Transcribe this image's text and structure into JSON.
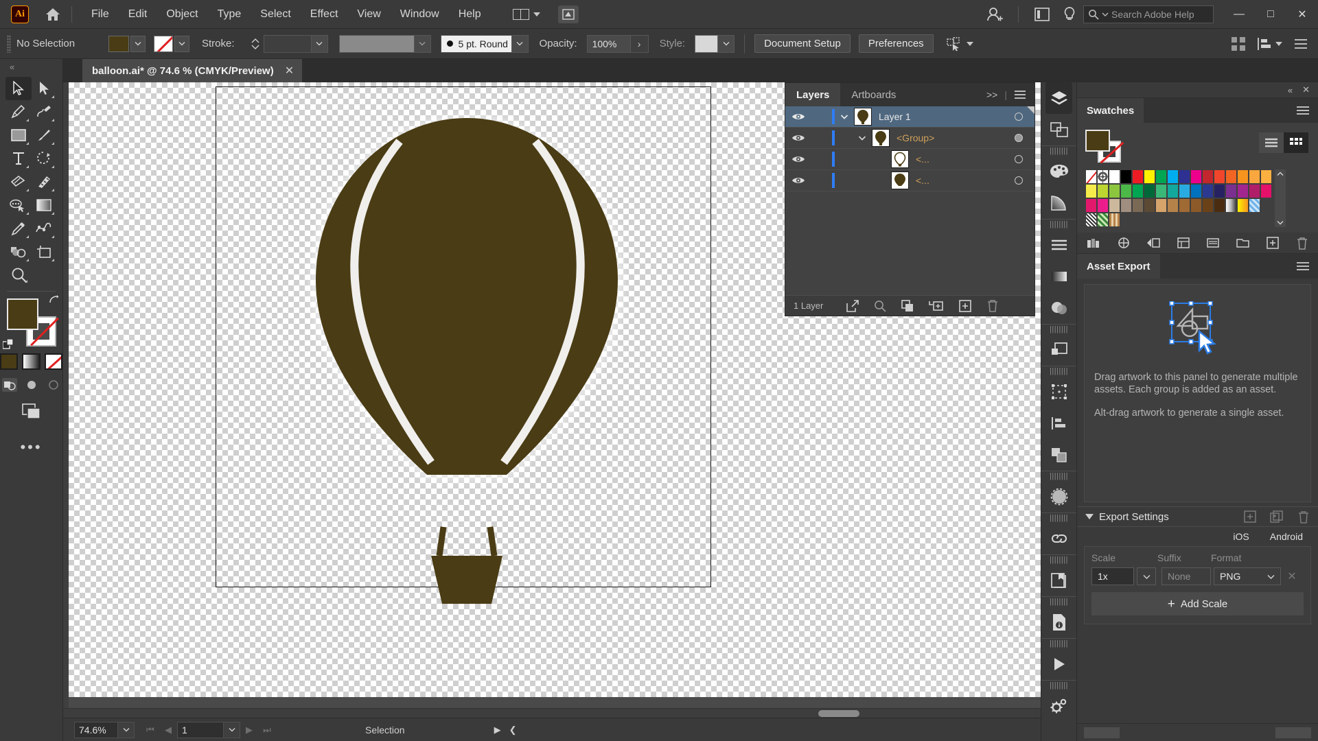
{
  "app": {
    "logo": "Ai",
    "name": "Adobe Illustrator"
  },
  "menubar": {
    "items": [
      "File",
      "Edit",
      "Object",
      "Type",
      "Select",
      "Effect",
      "View",
      "Window",
      "Help"
    ],
    "search_placeholder": "Search Adobe Help",
    "window_controls": {
      "minimize": "—",
      "maximize": "□",
      "close": "✕"
    }
  },
  "controlbar": {
    "selection_status": "No Selection",
    "fill_color": "#4a3c14",
    "stroke_color": "None",
    "stroke_label": "Stroke:",
    "stroke_weight": "",
    "variable_width_profile": "",
    "brush_definition": "5 pt. Round",
    "opacity_label": "Opacity:",
    "opacity_value": "100%",
    "style_label": "Style:",
    "document_setup_label": "Document Setup",
    "preferences_label": "Preferences"
  },
  "toolbar": {
    "tools": [
      {
        "name": "selection-tool",
        "active": true
      },
      {
        "name": "direct-selection-tool",
        "active": false
      },
      {
        "name": "pen-tool",
        "active": false
      },
      {
        "name": "curvature-tool",
        "active": false
      },
      {
        "name": "rectangle-tool",
        "active": false
      },
      {
        "name": "paintbrush-tool",
        "active": false
      },
      {
        "name": "type-tool",
        "active": false
      },
      {
        "name": "rotate-tool",
        "active": false
      },
      {
        "name": "eraser-tool",
        "active": false
      },
      {
        "name": "scale-tool",
        "active": false
      },
      {
        "name": "width-tool",
        "active": false
      },
      {
        "name": "gradient-tool",
        "active": false
      },
      {
        "name": "eyedropper-tool",
        "active": false
      },
      {
        "name": "blend-tool",
        "active": false
      },
      {
        "name": "shape-builder-tool",
        "active": false
      },
      {
        "name": "artboard-tool",
        "active": false
      },
      {
        "name": "zoom-tool",
        "active": false
      }
    ],
    "fill_color": "#4a3c14",
    "stroke_color": "None",
    "more_tools": "•••"
  },
  "document": {
    "tab_title": "balloon.ai* @ 74.6 % (CMYK/Preview)",
    "close_label": "✕",
    "artwork": {
      "name": "hot-air-balloon",
      "fill": "#4a3c14"
    }
  },
  "statusbar": {
    "zoom_level": "74.6%",
    "page_number": "1",
    "status_text": "Selection"
  },
  "layers_panel": {
    "tabs": [
      {
        "label": "Layers",
        "active": true
      },
      {
        "label": "Artboards",
        "active": false
      }
    ],
    "expand_label": ">>",
    "rows": [
      {
        "name": "Layer 1",
        "selected": true,
        "expanded": true,
        "indent": 0,
        "thumb": "balloon-dark",
        "target_filled": false,
        "has_corner": true
      },
      {
        "name": "<Group>",
        "selected": false,
        "expanded": true,
        "indent": 1,
        "thumb": "balloon-dark",
        "target_filled": true,
        "has_corner": false
      },
      {
        "name": "<...",
        "selected": false,
        "expanded": null,
        "indent": 2,
        "thumb": "balloon-outline",
        "target_filled": false,
        "has_corner": false
      },
      {
        "name": "<...",
        "selected": false,
        "expanded": null,
        "indent": 2,
        "thumb": "balloon-solid",
        "target_filled": false,
        "has_corner": false
      }
    ],
    "footer_label": "1 Layer"
  },
  "swatches_panel": {
    "title": "Swatches",
    "fill_color": "#4a3c14",
    "stroke_color": "None",
    "rows": [
      [
        "none",
        "registration",
        "#ffffff",
        "#000000",
        "#ed1c24",
        "#fff200",
        "#00a651",
        "#00aeef",
        "#2e3192",
        "#ec008c",
        "#c1272d",
        "#f1462c",
        "#f26522",
        "#f7941e",
        "#f9a73e",
        "#fbb040"
      ],
      [
        "#f5ec4b",
        "#bcd531",
        "#8cc63f",
        "#4cb848",
        "#00a551",
        "#006838",
        "#3bb878",
        "#12a89d",
        "#29abe2",
        "#0071bc",
        "#2b3990",
        "#262262",
        "#7b2f8e",
        "#a3258f",
        "#b01e6a",
        "#e4106a"
      ],
      [
        "#e2186c",
        "#ec1c8c",
        "#cbb89d",
        "#a08e80",
        "#7a6a55",
        "#5c4a35",
        "#d6a46a",
        "#b5824a",
        "#a06a35",
        "#8c5a28",
        "#6b4218",
        "#4a2d10",
        "gradient-white",
        "gradient-yellow",
        "pattern-blue",
        ""
      ],
      [
        "pattern-dots",
        "pattern-green",
        "pattern-leopard",
        "",
        "",
        "",
        "",
        "",
        "",
        "",
        "",
        "",
        "",
        "",
        "",
        ""
      ]
    ]
  },
  "asset_export_panel": {
    "title": "Asset Export",
    "drop_text_1": "Drag artwork to this panel to generate multiple assets. Each group is added as an asset.",
    "drop_text_2": "Alt-drag artwork to generate a single asset.",
    "export_settings_label": "Export Settings",
    "platforms": [
      "iOS",
      "Android"
    ],
    "column_headers": [
      "Scale",
      "Suffix",
      "Format"
    ],
    "scale_value": "1x",
    "suffix_placeholder": "None",
    "format_value": "PNG",
    "add_scale_label": "Add Scale"
  },
  "rail": {
    "icons": [
      {
        "name": "layers-icon",
        "active": true
      },
      {
        "name": "artboards-icon",
        "active": false
      },
      {
        "name": "color-palette-icon",
        "active": false
      },
      {
        "name": "color-guide-icon",
        "active": false
      },
      {
        "name": "stroke-icon",
        "active": false
      },
      {
        "name": "gradient-icon",
        "active": false
      },
      {
        "name": "transparency-icon",
        "active": false
      },
      {
        "name": "appearance-icon",
        "active": false
      },
      {
        "name": "transform-icon",
        "active": false
      },
      {
        "name": "align-icon",
        "active": false
      },
      {
        "name": "pathfinder-icon",
        "active": false
      },
      {
        "name": "brushes-icon",
        "active": false
      },
      {
        "name": "links-icon",
        "active": false
      },
      {
        "name": "libraries-icon",
        "active": false
      },
      {
        "name": "document-info-icon",
        "active": false
      },
      {
        "name": "actions-icon",
        "active": false
      },
      {
        "name": "settings-icon",
        "active": false
      }
    ]
  },
  "colors": {
    "panel_bg": "#3a3a3a",
    "panel_bg_alt": "#424242",
    "selection_blue": "#4f6880",
    "accent_blue": "#2f7df6",
    "artwork_brown": "#4a3c14"
  }
}
